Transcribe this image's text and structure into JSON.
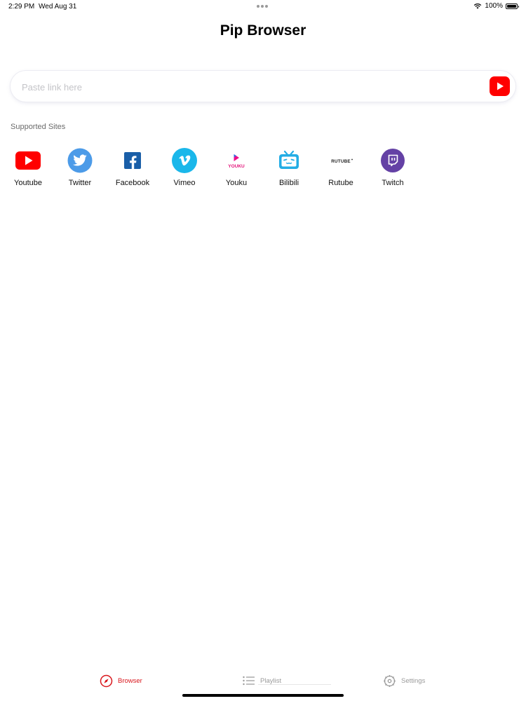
{
  "status_bar": {
    "time": "2:29 PM",
    "date": "Wed Aug 31",
    "battery": "100%",
    "battery_level": 1.0
  },
  "header": {
    "title": "Pip Browser"
  },
  "search": {
    "placeholder": "Paste link here",
    "value": ""
  },
  "supported_sites": {
    "label": "Supported Sites",
    "items": [
      {
        "label": "Youtube",
        "icon": "youtube-icon",
        "color": "#ff0000"
      },
      {
        "label": "Twitter",
        "icon": "twitter-icon",
        "color": "#4c9be8"
      },
      {
        "label": "Facebook",
        "icon": "facebook-icon",
        "color": "#1a5fa8"
      },
      {
        "label": "Vimeo",
        "icon": "vimeo-icon",
        "color": "#1ab7ea"
      },
      {
        "label": "Youku",
        "icon": "youku-icon",
        "color": "#ee0c8a",
        "logo_text": "YOUKU"
      },
      {
        "label": "Bilibili",
        "icon": "bilibili-icon",
        "color": "#23ade5"
      },
      {
        "label": "Rutube",
        "icon": "rutube-icon",
        "color": "#222222",
        "logo_text": "RUTUBE"
      },
      {
        "label": "Twitch",
        "icon": "twitch-icon",
        "color": "#6441a5"
      }
    ]
  },
  "tab_bar": {
    "accent": "#d9161c",
    "tabs": [
      {
        "label": "Browser",
        "icon": "compass-icon",
        "active": true
      },
      {
        "label": "Playlist",
        "icon": "list-icon",
        "active": false
      },
      {
        "label": "Settings",
        "icon": "gear-icon",
        "active": false
      }
    ]
  }
}
